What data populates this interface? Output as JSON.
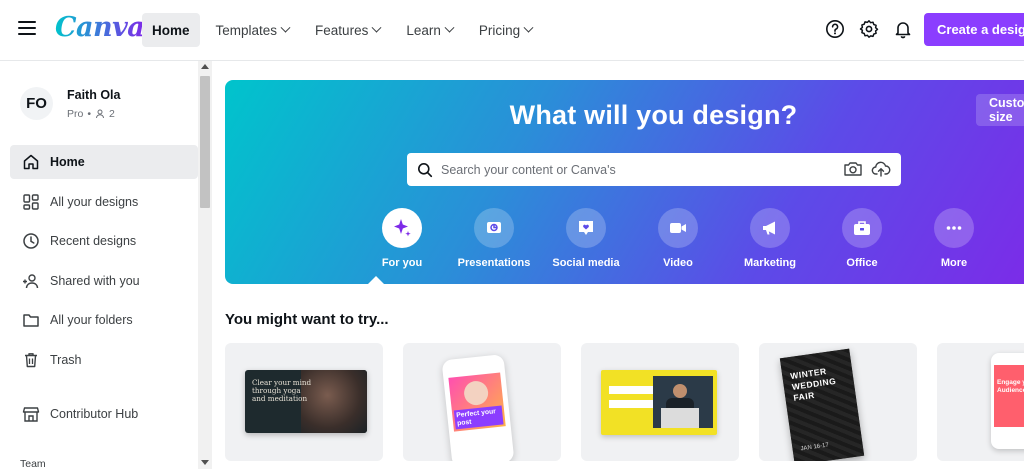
{
  "header": {
    "logo": "Canva",
    "nav": [
      {
        "label": "Home",
        "active": true,
        "dropdown": false
      },
      {
        "label": "Templates",
        "active": false,
        "dropdown": true
      },
      {
        "label": "Features",
        "active": false,
        "dropdown": true
      },
      {
        "label": "Learn",
        "active": false,
        "dropdown": true
      },
      {
        "label": "Pricing",
        "active": false,
        "dropdown": true
      }
    ],
    "icons": [
      "help-icon",
      "settings-icon",
      "bell-icon"
    ],
    "create_label": "Create a design",
    "accent": "#8b3dff"
  },
  "sidebar": {
    "profile": {
      "initials": "FO",
      "name": "Faith Ola",
      "plan": "Pro",
      "members": "2"
    },
    "items": [
      {
        "label": "Home",
        "icon": "home-icon",
        "active": true
      },
      {
        "label": "All your designs",
        "icon": "grid-icon",
        "active": false
      },
      {
        "label": "Recent designs",
        "icon": "clock-icon",
        "active": false
      },
      {
        "label": "Shared with you",
        "icon": "shared-users-icon",
        "active": false
      },
      {
        "label": "All your folders",
        "icon": "folder-icon",
        "active": false
      },
      {
        "label": "Trash",
        "icon": "trash-icon",
        "active": false
      },
      {
        "label": "Contributor Hub",
        "icon": "store-icon",
        "active": false
      }
    ],
    "team_label": "Team"
  },
  "hero": {
    "title": "What will you design?",
    "custom_label": "Custom size",
    "search_placeholder": "Search your content or Canva's",
    "gradient": [
      "#00c4cc",
      "#7d2ae8"
    ],
    "categories": [
      {
        "label": "For you",
        "icon": "sparkle-icon",
        "active": true
      },
      {
        "label": "Presentations",
        "icon": "presentation-icon",
        "active": false
      },
      {
        "label": "Social media",
        "icon": "heart-chat-icon",
        "active": false
      },
      {
        "label": "Video",
        "icon": "video-camera-icon",
        "active": false
      },
      {
        "label": "Marketing",
        "icon": "megaphone-icon",
        "active": false
      },
      {
        "label": "Office",
        "icon": "briefcase-icon",
        "active": false
      },
      {
        "label": "More",
        "icon": "more-icon",
        "active": false
      }
    ]
  },
  "suggestions": {
    "title": "You might want to try...",
    "cards": [
      {
        "kind": "presentation",
        "text": "Clear your mind through yoga and meditation"
      },
      {
        "kind": "instagram-post",
        "text": "Perfect your post"
      },
      {
        "kind": "video",
        "text": ""
      },
      {
        "kind": "invitation",
        "text": "WINTER WEDDING FAIR",
        "date": "JAN 16-17"
      },
      {
        "kind": "social",
        "text": "Engage your Audience"
      }
    ]
  }
}
